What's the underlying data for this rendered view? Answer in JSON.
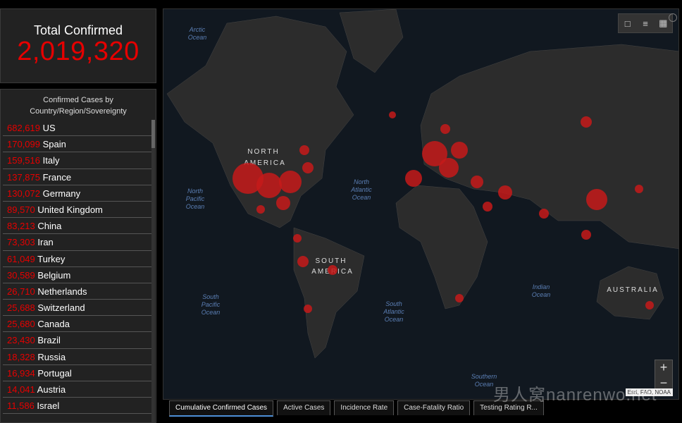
{
  "total": {
    "title": "Total Confirmed",
    "value": "2,019,320"
  },
  "list": {
    "header_line1": "Confirmed Cases by",
    "header_line2": "Country/Region/Sovereignty",
    "rows": [
      {
        "num": "682,619",
        "name": "US"
      },
      {
        "num": "170,099",
        "name": "Spain"
      },
      {
        "num": "159,516",
        "name": "Italy"
      },
      {
        "num": "137,875",
        "name": "France"
      },
      {
        "num": "130,072",
        "name": "Germany"
      },
      {
        "num": "89,570",
        "name": "United Kingdom"
      },
      {
        "num": "83,213",
        "name": "China"
      },
      {
        "num": "73,303",
        "name": "Iran"
      },
      {
        "num": "61,049",
        "name": "Turkey"
      },
      {
        "num": "30,589",
        "name": "Belgium"
      },
      {
        "num": "26,710",
        "name": "Netherlands"
      },
      {
        "num": "25,688",
        "name": "Switzerland"
      },
      {
        "num": "25,680",
        "name": "Canada"
      },
      {
        "num": "23,430",
        "name": "Brazil"
      },
      {
        "num": "18,328",
        "name": "Russia"
      },
      {
        "num": "16,934",
        "name": "Portugal"
      },
      {
        "num": "14,041",
        "name": "Austria"
      },
      {
        "num": "11,586",
        "name": "Israel"
      }
    ]
  },
  "map": {
    "oceans": [
      {
        "id": "arctic",
        "l1": "Arctic",
        "l2": "Ocean"
      },
      {
        "id": "npac",
        "l1": "North",
        "l2": "Pacific",
        "l3": "Ocean"
      },
      {
        "id": "natl",
        "l1": "North",
        "l2": "Atlantic",
        "l3": "Ocean"
      },
      {
        "id": "spac",
        "l1": "South",
        "l2": "Pacific",
        "l3": "Ocean"
      },
      {
        "id": "satl",
        "l1": "South",
        "l2": "Atlantic",
        "l3": "Ocean"
      },
      {
        "id": "ind",
        "l1": "Indian",
        "l2": "Ocean"
      },
      {
        "id": "south",
        "l1": "Southern",
        "l2": "Ocean"
      }
    ],
    "continents": [
      {
        "id": "na",
        "l1": "NORTH",
        "l2": "AMERICA"
      },
      {
        "id": "sa",
        "l1": "SOUTH",
        "l2": "AMERICA"
      },
      {
        "id": "au",
        "l1": "AUSTRALIA"
      }
    ],
    "attribution": "Esri, FAO, NOAA",
    "tools": [
      "bookmark-icon",
      "legend-icon",
      "qr-icon"
    ],
    "zoom_in": "+",
    "zoom_out": "−"
  },
  "tabs": [
    {
      "label": "Cumulative Confirmed Cases",
      "active": true
    },
    {
      "label": "Active Cases"
    },
    {
      "label": "Incidence Rate"
    },
    {
      "label": "Case-Fatality Ratio"
    },
    {
      "label": "Testing Rating R..."
    }
  ],
  "watermark": "男人窝nanrenwo.net"
}
